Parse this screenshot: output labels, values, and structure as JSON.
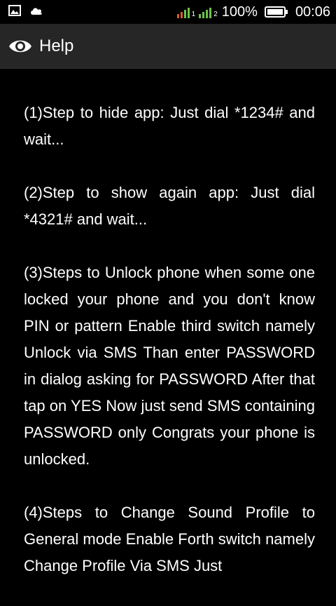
{
  "status_bar": {
    "battery_percent_label": "100%",
    "battery_level": 1.0,
    "time": "00:06",
    "sim1_label": "1",
    "sim2_label": "2",
    "icons": [
      "image-icon",
      "cloud-icon",
      "signal-icon",
      "battery-icon"
    ]
  },
  "action_bar": {
    "icon": "eye-icon",
    "title": "Help"
  },
  "help": {
    "paragraphs": [
      "(1)Step to hide app: Just dial *1234# and wait...",
      "(2)Step to show again app: Just dial *4321# and wait...",
      "(3)Steps to Unlock phone when some one locked your phone and you don't know PIN or pattern Enable third switch namely Unlock via SMS Than enter PASSWORD in dialog asking for PASSWORD After that tap on YES Now just send SMS containing PASSWORD only Congrats your phone is unlocked.",
      "(4)Steps to Change Sound Profile to General mode Enable Forth switch namely Change Profile Via SMS Just"
    ]
  }
}
